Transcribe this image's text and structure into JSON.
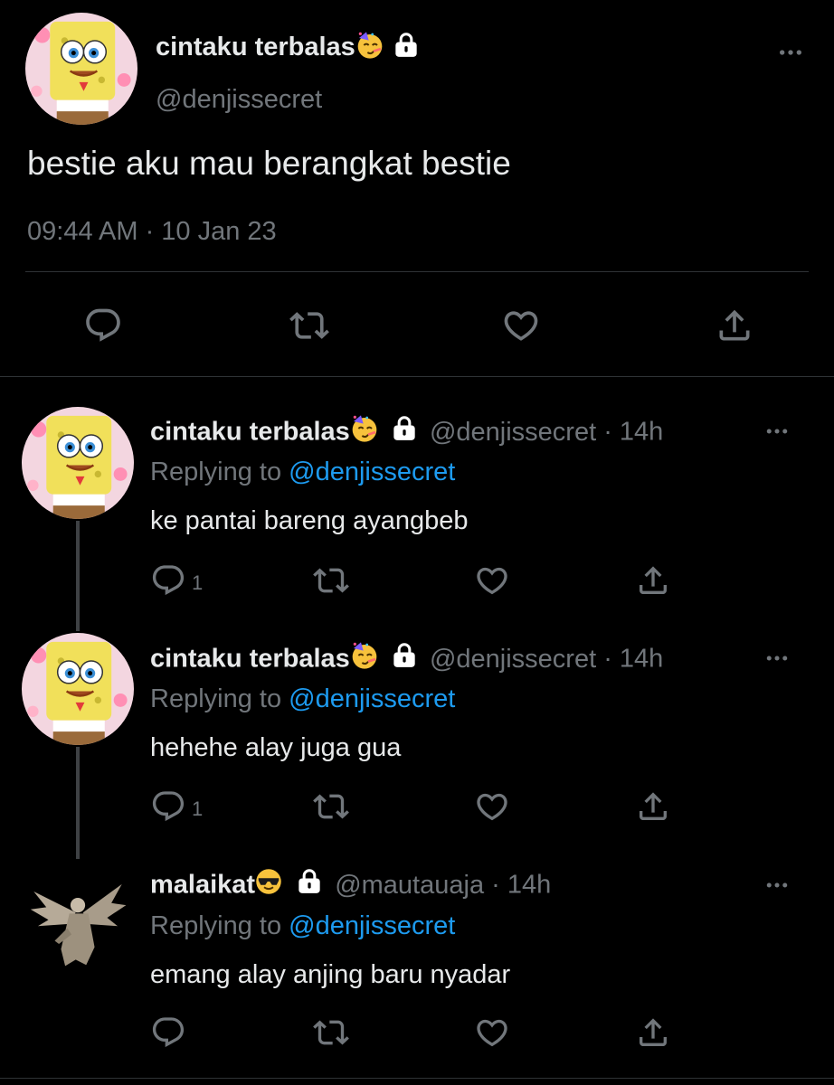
{
  "main_tweet": {
    "display_name": "cintaku terbalas",
    "handle": "@denjissecret",
    "text": "bestie aku mau berangkat bestie",
    "timestamp": "09:44 AM · 10 Jan 23"
  },
  "replies": [
    {
      "display_name": "cintaku terbalas",
      "handle": "@denjissecret",
      "time": "· 14h",
      "replying_label": "Replying to",
      "replying_to": "@denjissecret",
      "text": "ke pantai bareng ayangbeb",
      "reply_count": "1"
    },
    {
      "display_name": "cintaku terbalas",
      "handle": "@denjissecret",
      "time": "· 14h",
      "replying_label": "Replying to",
      "replying_to": "@denjissecret",
      "text": "hehehe alay juga gua",
      "reply_count": "1"
    },
    {
      "display_name": "malaikat",
      "handle": "@mautauaja",
      "time": "· 14h",
      "replying_label": "Replying to",
      "replying_to": "@denjissecret",
      "text": "emang alay anjing baru nyadar",
      "reply_count": ""
    }
  ],
  "icons": {
    "reply": "reply-icon",
    "retweet": "retweet-icon",
    "like": "like-icon",
    "share": "share-icon",
    "more": "more-icon",
    "lock": "lock-icon",
    "party_face": "party-face-emoji",
    "sunglasses": "sunglasses-emoji"
  },
  "colors": {
    "background": "#000000",
    "text": "#e7e9ea",
    "muted": "#71767b",
    "link": "#1d9bf0",
    "divider": "#2f3336"
  }
}
